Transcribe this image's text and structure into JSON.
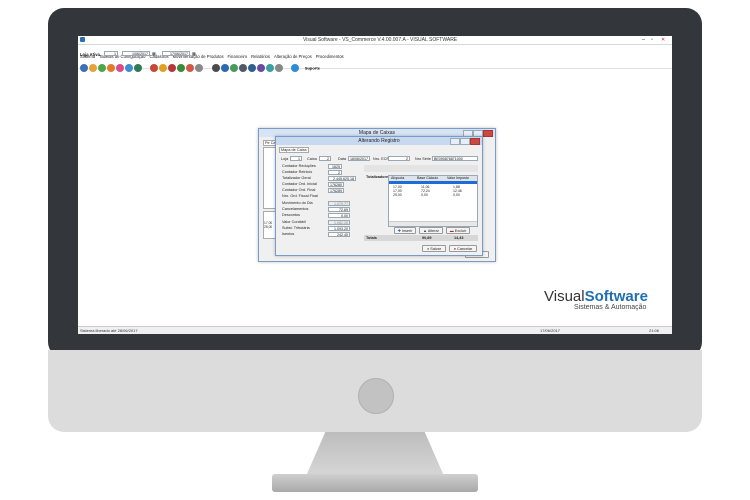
{
  "app": {
    "window_title": "Visual Software - VS_Commerce V.4.00.007.A - VISUAL SOFTWARE",
    "menu": [
      "Sistema",
      "Tabelas de Configuração",
      "Cadastros",
      "Movimentação de Produtos",
      "Financeiro",
      "Relatórios",
      "Alteração de Preços",
      "Procedimentos"
    ],
    "filter": {
      "loja_label": "Loja Ativa",
      "loja_value": "1",
      "date_from": "1/06/2017",
      "date_to": "17/06/2017"
    },
    "toolbar_last_label": "Suporte",
    "status_left": "Sistema liberado até 28/06/2017",
    "status_date": "17/06/2017",
    "status_time": "21:06"
  },
  "mapa_window": {
    "title": "Mapa de Caixas",
    "tab": "Pe Caixa",
    "sair_label": "Sair",
    "mini_values": [
      "17,00",
      "25,00"
    ]
  },
  "dialog": {
    "title": "Alterando Registro",
    "tab": "Mapa de Caixa",
    "header": {
      "loja_label": "Loja",
      "loja_value": "1",
      "caixa_label": "Caixa",
      "caixa_value": "2",
      "data_label": "Data",
      "data_value": "16/06/2017",
      "ecf_label": "Nro. ECF",
      "ecf_value": "2",
      "serie_label": "Nro Série",
      "serie_value": "BE090876871000"
    },
    "fields": [
      {
        "label": "Contador Reduções",
        "value": "1625"
      },
      {
        "label": "Contador Reinicio",
        "value": "2"
      },
      {
        "label": "Totalizador Geral",
        "value": "2.445.625,18"
      },
      {
        "label": "Contador Ord. Inicial",
        "value": "176280"
      },
      {
        "label": "Contador Ord. Final",
        "value": "176289"
      },
      {
        "label": "Nro. Ord. Fiscal Final",
        "value": ""
      },
      {
        "label": "Movimento do Dia",
        "value": "1.079,77"
      },
      {
        "label": "Cancelamentos",
        "value": "72,69"
      },
      {
        "label": "Descontos",
        "value": "0,00"
      },
      {
        "label": "Valor Contábil",
        "value": "1.082,26"
      },
      {
        "label": "Subst. Tributária",
        "value": "1.093,20"
      },
      {
        "label": "Isentos",
        "value": "242,40"
      }
    ],
    "totalizadores": {
      "title": "Totalizadores Tributados",
      "columns": [
        "Alíquota",
        "Base Cálculo",
        "Valor Imposto"
      ],
      "rows": [
        [
          "",
          "",
          ""
        ],
        [
          "17,00",
          "11,06",
          "1,88"
        ],
        [
          "17,00",
          "72,24",
          "12,46"
        ],
        [
          "25,00",
          "0,00",
          "0,00"
        ]
      ],
      "buttons": [
        "Inserir",
        "Alterar",
        "Excluir"
      ],
      "total_label": "Totais",
      "total_base": "90,89",
      "total_imposto": "14,43"
    },
    "salvar_label": "Salvar",
    "cancelar_label": "Cancelar"
  },
  "brand": {
    "part1": "Visual",
    "part2": "Software",
    "tagline": "Sistemas & Automação"
  },
  "colors": {
    "brand_dark": "#333333",
    "brand_blue": "#1f6fb2",
    "bezel": "#33373b",
    "window_border": "#7a9bc6"
  },
  "icons": [
    "vs-logo-icon",
    "save-icon",
    "cancel-icon",
    "toolbar-module-icons"
  ]
}
